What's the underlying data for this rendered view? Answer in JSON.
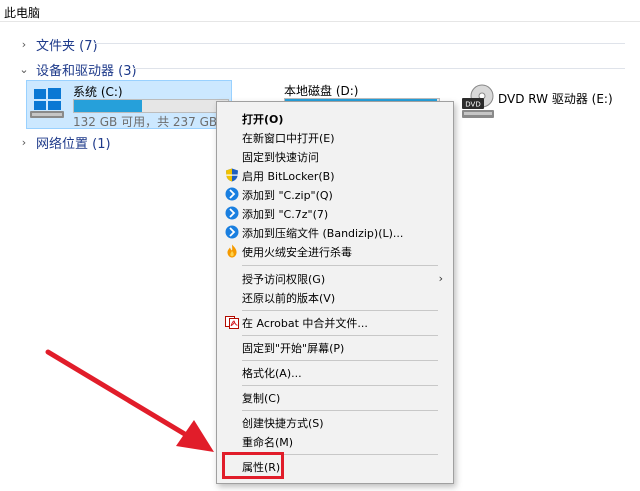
{
  "window": {
    "title": "此电脑"
  },
  "groups": [
    {
      "label": "文件夹 (7)",
      "expanded": false
    },
    {
      "label": "设备和驱动器 (3)",
      "expanded": true
    },
    {
      "label": "网络位置 (1)",
      "expanded": false
    }
  ],
  "drives": [
    {
      "name": "系统 (C:)",
      "info": "132 GB 可用，共 237 GB",
      "used_fraction": 0.44,
      "selected": true,
      "icon": "windows-drive-icon"
    },
    {
      "name": "本地磁盘 (D:)",
      "used_fraction": 0.99,
      "selected": false,
      "icon": "hard-drive-icon"
    },
    {
      "name": "DVD RW 驱动器 (E:)",
      "selected": false,
      "icon": "dvd-drive-icon",
      "icon_text": "DVD"
    }
  ],
  "context_menu": {
    "items": [
      {
        "label": "打开(O)",
        "bold": true
      },
      {
        "label": "在新窗口中打开(E)"
      },
      {
        "label": "固定到快速访问"
      },
      {
        "label": "启用 BitLocker(B)",
        "icon": "shield-icon"
      },
      {
        "label": "添加到 \"C.zip\"(Q)",
        "icon": "bandizip-icon"
      },
      {
        "label": "添加到 \"C.7z\"(7)",
        "icon": "bandizip-icon"
      },
      {
        "label": "添加到压缩文件 (Bandizip)(L)...",
        "icon": "bandizip-icon"
      },
      {
        "label": "使用火绒安全进行杀毒",
        "icon": "huorong-icon"
      },
      {
        "label": "授予访问权限(G)",
        "submenu": true
      },
      {
        "label": "还原以前的版本(V)"
      },
      {
        "label": "在 Acrobat 中合并文件...",
        "icon": "acrobat-icon"
      },
      {
        "label": "固定到\"开始\"屏幕(P)"
      },
      {
        "label": "格式化(A)..."
      },
      {
        "label": "复制(C)"
      },
      {
        "label": "创建快捷方式(S)"
      },
      {
        "label": "重命名(M)"
      },
      {
        "label": "属性(R)"
      }
    ]
  },
  "colors": {
    "accent": "#26a0da",
    "selection": "#cce8ff",
    "annotation": "#e11d2a",
    "group_text": "#1e3a8a"
  }
}
